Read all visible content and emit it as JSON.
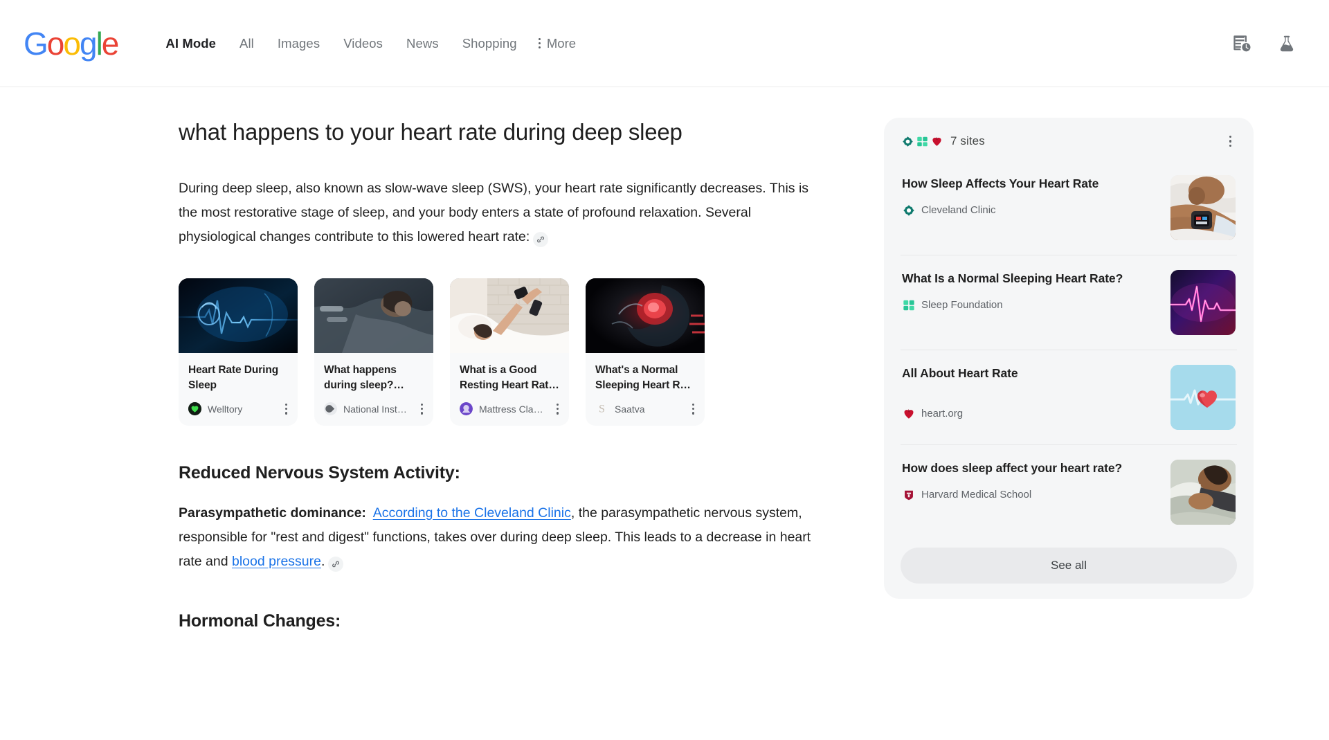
{
  "header": {
    "logo": {
      "letters": [
        "G",
        "o",
        "o",
        "g",
        "l",
        "e"
      ]
    },
    "nav": [
      {
        "label": "AI Mode",
        "active": true
      },
      {
        "label": "All",
        "active": false
      },
      {
        "label": "Images",
        "active": false
      },
      {
        "label": "Videos",
        "active": false
      },
      {
        "label": "News",
        "active": false
      },
      {
        "label": "Shopping",
        "active": false
      }
    ],
    "more_label": "More",
    "icons": [
      {
        "name": "search-history-icon"
      },
      {
        "name": "labs-flask-icon"
      }
    ]
  },
  "main": {
    "query_title": "what happens to your heart rate during deep sleep",
    "intro_paragraph": "During deep sleep, also known as slow-wave sleep (SWS), your heart rate significantly decreases. This is the most restorative stage of sleep, and your body enters a state of profound relaxation. Several physiological changes contribute to this lowered heart rate:",
    "cards": [
      {
        "title": "Heart Rate During Sleep",
        "source": "Welltory",
        "favicon": "welltory-favicon",
        "image": "ecg-heart-blue-thumbnail"
      },
      {
        "title": "What happens during sleep?…",
        "source": "National Inst…",
        "favicon": "nih-favicon",
        "image": "woman-sleeping-dark-thumbnail"
      },
      {
        "title": "What is a Good Resting Heart Rat…",
        "source": "Mattress Cla…",
        "favicon": "mattress-clarity-favicon",
        "image": "woman-in-bed-smartwatch-thumbnail"
      },
      {
        "title": "What's a Normal Sleeping Heart R…",
        "source": "Saatva",
        "favicon": "saatva-favicon",
        "image": "anatomical-heart-red-thumbnail"
      }
    ],
    "sections": [
      {
        "heading": "Reduced Nervous System Activity:",
        "lead_label": "Parasympathetic dominance:",
        "link_text": "According to the Cleveland Clinic",
        "body_part_1": ", the parasympathetic nervous system, responsible for \"rest and digest\" functions, takes over during deep sleep. This leads to a decrease in heart rate and ",
        "link_text_2": "blood pressure",
        "body_part_2": "."
      },
      {
        "heading": "Hormonal Changes:"
      }
    ]
  },
  "sidebar": {
    "sites_count_label": "7 sites",
    "stack_favicons": [
      "cleveland-clinic-favicon",
      "sleep-foundation-favicon",
      "heart-org-favicon"
    ],
    "sources": [
      {
        "title": "How Sleep Affects Your Heart Rate",
        "site": "Cleveland Clinic",
        "favicon": "cleveland-clinic-favicon",
        "thumb": "man-sleeping-smartwatch-thumbnail"
      },
      {
        "title": "What Is a Normal Sleeping Heart Rate?",
        "site": "Sleep Foundation",
        "favicon": "sleep-foundation-favicon",
        "thumb": "ecg-neon-purple-thumbnail"
      },
      {
        "title": "All About Heart Rate",
        "site": "heart.org",
        "favicon": "heart-org-favicon",
        "thumb": "red-heart-blue-bg-thumbnail"
      },
      {
        "title": "How does sleep affect your heart rate?",
        "site": "Harvard Medical School",
        "favicon": "harvard-favicon",
        "thumb": "person-sleeping-pillow-thumbnail"
      }
    ],
    "see_all_label": "See all"
  },
  "colors": {
    "link": "#1a73e8",
    "panel_bg": "#f5f6f7",
    "card_bg": "#f8f9fa",
    "text": "#1f1f1f",
    "muted": "#5f6368"
  }
}
